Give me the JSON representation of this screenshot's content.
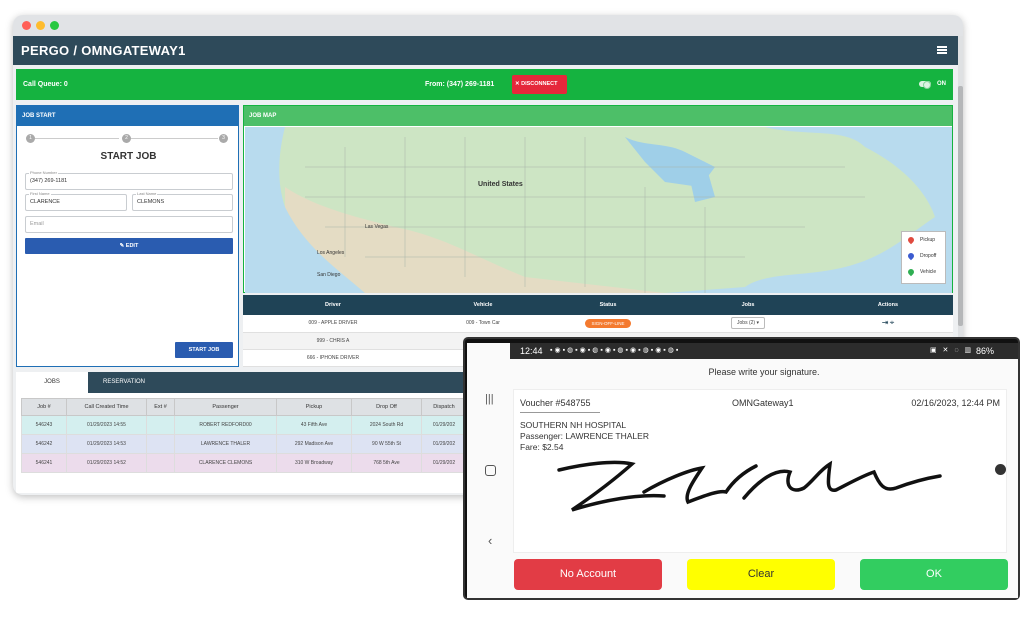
{
  "app": {
    "title": "PERGO / OMNGATEWAY1"
  },
  "callbar": {
    "queue": "Call Queue: 0",
    "from": "From: (347) 269-1181",
    "disconnect": "DISCONNECT",
    "toggle": "ON"
  },
  "job_start": {
    "header": "JOB START",
    "steps": [
      "1",
      "2",
      "3"
    ],
    "title": "START JOB",
    "phone": {
      "label": "Phone Number",
      "value": "(347) 269-1181"
    },
    "first_name": {
      "label": "First Name",
      "value": "CLARENCE"
    },
    "last_name": {
      "label": "Last Name",
      "value": "CLEMONS"
    },
    "email": {
      "placeholder": "Email"
    },
    "edit_button": "EDIT",
    "start_button": "START JOB"
  },
  "job_map": {
    "header": "JOB MAP",
    "labels": {
      "country": "United States",
      "city1": "Las Vegas",
      "city2": "Los Angeles",
      "city3": "San Diego"
    },
    "legend": [
      "Pickup",
      "Dropoff",
      "Vehicle"
    ]
  },
  "drivers": {
    "columns": [
      "Driver",
      "Vehicle",
      "Status",
      "Jobs",
      "Actions"
    ],
    "rows": [
      {
        "driver": "009 - APPLE DRIVER",
        "vehicle": "009 - Town Car",
        "status": "SIGN-OFF-LINE",
        "jobs": "Jobs (2)"
      },
      {
        "driver": "999 - CHRIS A",
        "vehicle": "",
        "status": "",
        "jobs": ""
      },
      {
        "driver": "666 - IPHONE DRIVER",
        "vehicle": "",
        "status": "",
        "jobs": ""
      }
    ]
  },
  "jobs": {
    "tabs": [
      "JOBS",
      "RESERVATION"
    ],
    "columns": [
      "Job #",
      "Call Created Time",
      "Ext #",
      "Passenger",
      "Pickup",
      "Drop Off",
      "Dispatch"
    ],
    "rows": [
      [
        "546243",
        "01/29/2023 14:55",
        "",
        "ROBERT REDFORD00",
        "43 Fifth Ave",
        "2024 South Rd",
        "01/29/202"
      ],
      [
        "546242",
        "01/29/2023 14:53",
        "",
        "LAWRENCE THALER",
        "292 Madison Ave",
        "90 W 55th St",
        "01/29/202"
      ],
      [
        "546241",
        "01/29/2023 14:52",
        "",
        "CLARENCE CLEMONS",
        "310 W Broadway",
        "768 5th Ave",
        "01/29/202"
      ]
    ],
    "row_colors": [
      "#d4efef",
      "#dde3f3",
      "#ecdcec"
    ]
  },
  "phone": {
    "time": "12:44",
    "battery": "86%",
    "prompt": "Please write your signature.",
    "voucher": "Voucher #548755",
    "gateway": "OMNGateway1",
    "datetime": "02/16/2023, 12:44 PM",
    "location": "SOUTHERN NH HOSPITAL",
    "passenger": "Passenger: LAWRENCE THALER",
    "fare": "Fare: $2.54",
    "buttons": {
      "no_account": "No Account",
      "clear": "Clear",
      "ok": "OK"
    },
    "colors": {
      "no_account": "#e23c45",
      "clear": "#ffff00",
      "ok": "#32cd60"
    }
  }
}
